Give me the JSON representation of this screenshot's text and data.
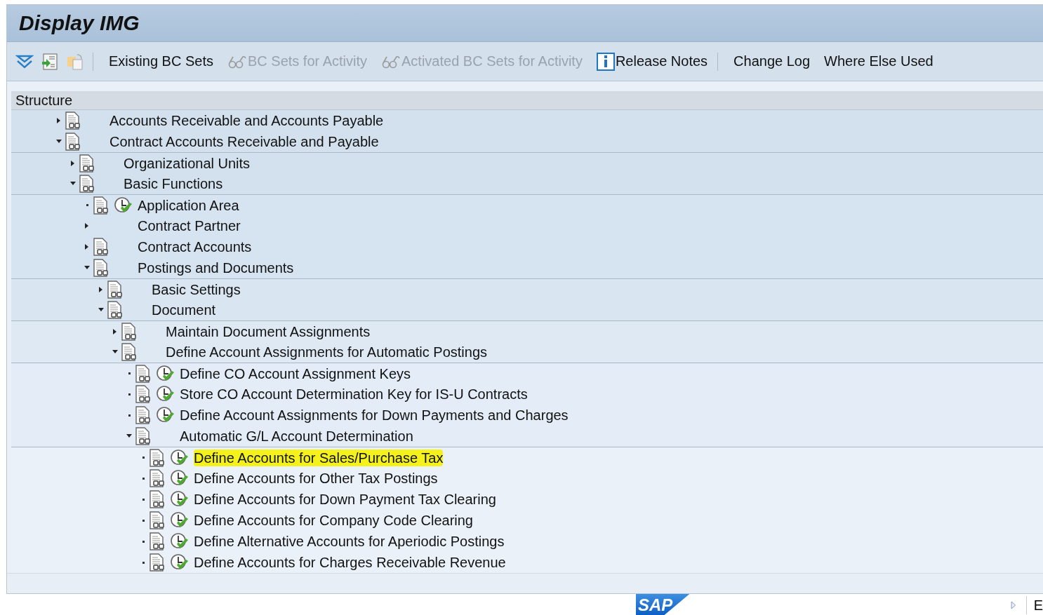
{
  "window": {
    "title": "Display IMG"
  },
  "toolbar": {
    "buttons": [
      {
        "label": "Existing BC Sets",
        "kind": "text",
        "disabled": false
      },
      {
        "label": "BC Sets for Activity",
        "kind": "glasses",
        "disabled": true
      },
      {
        "label": "Activated BC Sets for Activity",
        "kind": "glasses",
        "disabled": true
      },
      {
        "label": "Release Notes",
        "kind": "info",
        "disabled": false
      },
      {
        "label": "Change Log",
        "kind": "text",
        "disabled": false
      },
      {
        "label": "Where Else Used",
        "kind": "text",
        "disabled": false
      }
    ]
  },
  "tree": {
    "header": "Structure",
    "items": [
      {
        "label": "Accounts Receivable and Accounts Payable",
        "kind": "doc",
        "expanded": false,
        "highlighted": false
      },
      {
        "label": "Contract Accounts Receivable and Payable",
        "kind": "doc",
        "expanded": true,
        "highlighted": false,
        "children": [
          {
            "label": "Organizational Units",
            "kind": "doc",
            "expanded": false,
            "highlighted": false
          },
          {
            "label": "Basic Functions",
            "kind": "doc",
            "expanded": true,
            "highlighted": false,
            "children": [
              {
                "label": "Application Area",
                "kind": "activity",
                "highlighted": false
              },
              {
                "label": "Contract Partner",
                "kind": "none",
                "expanded": false,
                "highlighted": false
              },
              {
                "label": "Contract Accounts",
                "kind": "doc",
                "expanded": false,
                "highlighted": false
              },
              {
                "label": "Postings and Documents",
                "kind": "doc",
                "expanded": true,
                "highlighted": false,
                "children": [
                  {
                    "label": "Basic Settings",
                    "kind": "doc",
                    "expanded": false,
                    "highlighted": false
                  },
                  {
                    "label": "Document",
                    "kind": "doc",
                    "expanded": true,
                    "highlighted": false,
                    "children": [
                      {
                        "label": "Maintain Document Assignments",
                        "kind": "doc",
                        "expanded": false,
                        "highlighted": false
                      },
                      {
                        "label": "Define Account Assignments for Automatic Postings",
                        "kind": "doc",
                        "expanded": true,
                        "highlighted": false,
                        "children": [
                          {
                            "label": "Define CO Account Assignment Keys",
                            "kind": "activity",
                            "highlighted": false
                          },
                          {
                            "label": "Store CO Account Determination Key for IS-U Contracts",
                            "kind": "activity",
                            "highlighted": false
                          },
                          {
                            "label": "Define Account Assignments for Down Payments and Charges",
                            "kind": "activity",
                            "highlighted": false
                          },
                          {
                            "label": "Automatic G/L Account Determination",
                            "kind": "doc",
                            "expanded": true,
                            "highlighted": false,
                            "children": [
                              {
                                "label": "Define Accounts for Sales/Purchase Tax",
                                "kind": "activity",
                                "highlighted": true
                              },
                              {
                                "label": "Define Accounts for Other Tax Postings",
                                "kind": "activity",
                                "highlighted": false
                              },
                              {
                                "label": "Define Accounts for Down Payment Tax Clearing",
                                "kind": "activity",
                                "highlighted": false
                              },
                              {
                                "label": "Define Accounts for Company Code Clearing",
                                "kind": "activity",
                                "highlighted": false
                              },
                              {
                                "label": "Define Alternative Accounts for Aperiodic Postings",
                                "kind": "activity",
                                "highlighted": false
                              },
                              {
                                "label": "Define Accounts for Charges Receivable Revenue",
                                "kind": "activity",
                                "highlighted": false
                              }
                            ]
                          }
                        ]
                      }
                    ]
                  }
                ]
              }
            ]
          }
        ]
      }
    ]
  },
  "footer": {
    "logo": "SAP",
    "text": "E"
  }
}
